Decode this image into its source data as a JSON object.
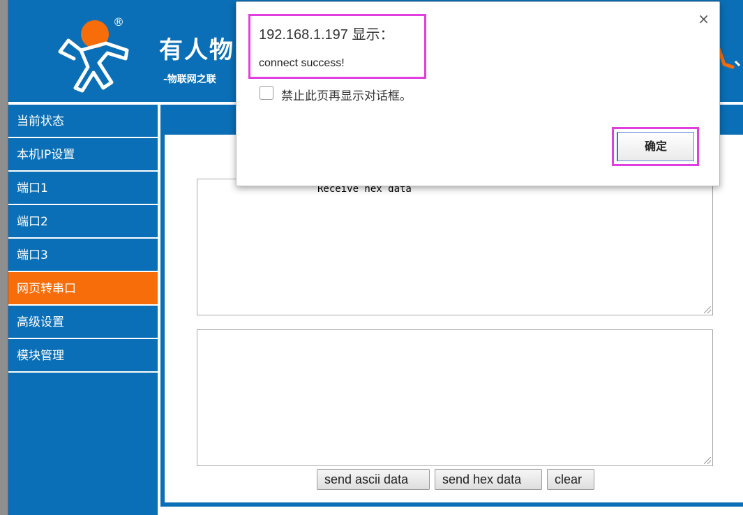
{
  "header": {
    "reg_mark": "®",
    "title": "有人物",
    "subtitle": "-物联网之联"
  },
  "sidebar": {
    "items": [
      {
        "label": "当前状态"
      },
      {
        "label": "本机IP设置"
      },
      {
        "label": "端口1"
      },
      {
        "label": "端口2"
      },
      {
        "label": "端口3"
      },
      {
        "label": "网页转串口",
        "active": true
      },
      {
        "label": "高级设置"
      },
      {
        "label": "模块管理"
      }
    ]
  },
  "main": {
    "receive_text": "Receive hex data",
    "send_text": "",
    "buttons": {
      "send_ascii": "send ascii data",
      "send_hex": "send hex data",
      "clear": "clear"
    }
  },
  "dialog": {
    "title": "192.168.1.197 显示：",
    "message": "connect success!",
    "checkbox_label": "禁止此页再显示对话框。",
    "ok_label": "确定",
    "close_glyph": "×"
  },
  "colors": {
    "brand_blue": "#0a6fb6",
    "active_orange": "#f76d0a",
    "highlight": "#e13ee0"
  },
  "icons": {
    "logo": "running-man-logo",
    "close": "close-icon"
  }
}
